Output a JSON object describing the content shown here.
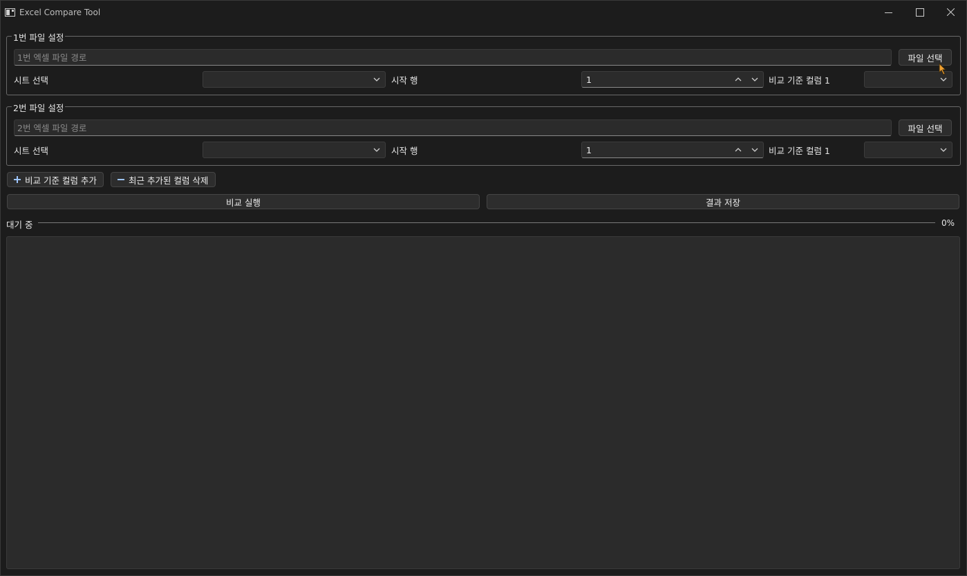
{
  "window": {
    "title": "Excel Compare Tool"
  },
  "group1": {
    "title": "1번 파일 설정",
    "path_placeholder": "1번 엑셀 파일 경로",
    "path_value": "",
    "file_button": "파일 선택",
    "sheet_label": "시트 선택",
    "sheet_value": "",
    "start_row_label": "시작 행",
    "start_row_value": "1",
    "key_column_label": "비교 기준 컬럼 1",
    "key_column_value": ""
  },
  "group2": {
    "title": "2번 파일 설정",
    "path_placeholder": "2번 엑셀 파일 경로",
    "path_value": "",
    "file_button": "파일 선택",
    "sheet_label": "시트 선택",
    "sheet_value": "",
    "start_row_label": "시작 행",
    "start_row_value": "1",
    "key_column_label": "비교 기준 컬럼 1",
    "key_column_value": ""
  },
  "actions": {
    "add_column": "비교 기준 컬럼 추가",
    "remove_column": "최근 추가된 컬럼 삭제",
    "run": "비교 실행",
    "save": "결과 저장"
  },
  "progress": {
    "status": "대기 중",
    "percent_label": "0%",
    "percent": 0
  },
  "result": {
    "text": ""
  },
  "colors": {
    "accent": "#4aa3ff",
    "background": "#1c1c1c",
    "panel": "#2b2b2b",
    "add_icon": "#9ec6ff"
  },
  "icons": {
    "add": "plus-icon",
    "remove": "minus-icon",
    "dropdown": "chevron-down-icon",
    "spin_up": "chevron-up-icon"
  }
}
